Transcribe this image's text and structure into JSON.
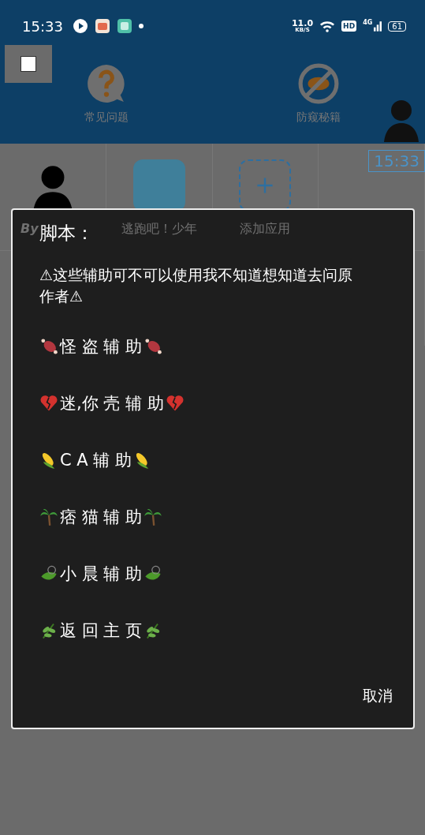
{
  "status_bar": {
    "time": "15:33",
    "net_speed": "11.0",
    "net_unit": "KB/S",
    "hd": "HD",
    "network": "4G",
    "battery": "61"
  },
  "header": {
    "actions": [
      {
        "label": "常见问题",
        "kind": "help"
      },
      {
        "label": "防窥秘籍",
        "kind": "privacy"
      }
    ],
    "clock": "15:33"
  },
  "apps": [
    {
      "label": "By",
      "kind": "avatar"
    },
    {
      "label": "逃跑吧！少年",
      "kind": "game"
    },
    {
      "label": "添加应用",
      "kind": "add"
    }
  ],
  "dialog": {
    "title": "脚本：",
    "notice": "⚠这些辅助可不可以使用我不知道想知道去问原作者⚠",
    "items": [
      {
        "label": "怪 盗 辅 助",
        "kind": "meat"
      },
      {
        "label": "迷,你 壳 辅 助",
        "kind": "heart"
      },
      {
        "label": "C A 辅 助",
        "kind": "corn"
      },
      {
        "label": "痞 猫 辅 助",
        "kind": "palm"
      },
      {
        "label": "小 晨 辅 助",
        "kind": "leaf"
      },
      {
        "label": "返 回 主 页",
        "kind": "herb"
      }
    ],
    "cancel": "取消"
  }
}
